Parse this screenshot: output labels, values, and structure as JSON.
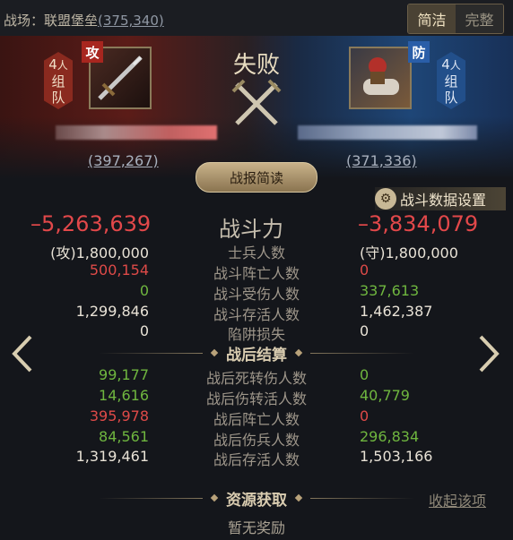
{
  "header": {
    "battlefield_label": "战场：联盟堡垒",
    "battlefield_coord": "(375,340)",
    "tab_brief": "简洁",
    "tab_full": "完整"
  },
  "attacker": {
    "badge": "攻",
    "group_count": "4",
    "group_unit": "人",
    "group_label_1": "组",
    "group_label_2": "队",
    "coord": "(397,267)"
  },
  "defender": {
    "badge": "防",
    "group_count": "4",
    "group_unit": "人",
    "group_label_1": "组",
    "group_label_2": "队",
    "coord": "(371,336)"
  },
  "result": "失败",
  "report_button": "战报简读",
  "settings_label": "战斗数据设置",
  "power": {
    "label": "战斗力",
    "left": "–5,263,639",
    "right": "–3,834,079"
  },
  "stats": [
    {
      "left": "(攻)1,800,000",
      "label": "士兵人数",
      "right": "(守)1,800,000",
      "lc": "white",
      "rc": "white"
    },
    {
      "left": "500,154",
      "label": "战斗阵亡人数",
      "right": "0",
      "lc": "red",
      "rc": "red"
    },
    {
      "left": "0",
      "label": "战斗受伤人数",
      "right": "337,613",
      "lc": "green",
      "rc": "green"
    },
    {
      "left": "1,299,846",
      "label": "战斗存活人数",
      "right": "1,462,387",
      "lc": "white",
      "rc": "white"
    },
    {
      "left": "0",
      "label": "陷阱损失",
      "right": "0",
      "lc": "white",
      "rc": "white"
    }
  ],
  "after_title": "战后结算",
  "after": [
    {
      "left": "99,177",
      "label": "战后死转伤人数",
      "right": "0",
      "lc": "green",
      "rc": "green"
    },
    {
      "left": "14,616",
      "label": "战后伤转活人数",
      "right": "40,779",
      "lc": "green",
      "rc": "green"
    },
    {
      "left": "395,978",
      "label": "战后阵亡人数",
      "right": "0",
      "lc": "red",
      "rc": "red"
    },
    {
      "left": "84,561",
      "label": "战后伤兵人数",
      "right": "296,834",
      "lc": "green",
      "rc": "green"
    },
    {
      "left": "1,319,461",
      "label": "战后存活人数",
      "right": "1,503,166",
      "lc": "white",
      "rc": "white"
    }
  ],
  "resource_title": "资源获取",
  "collapse_label": "收起该项",
  "no_reward": "暂无奖励",
  "icons": {
    "prev": "chevron-left-icon",
    "next": "chevron-right-icon",
    "swords": "crossed-swords-icon",
    "settings": "gear-icon"
  }
}
